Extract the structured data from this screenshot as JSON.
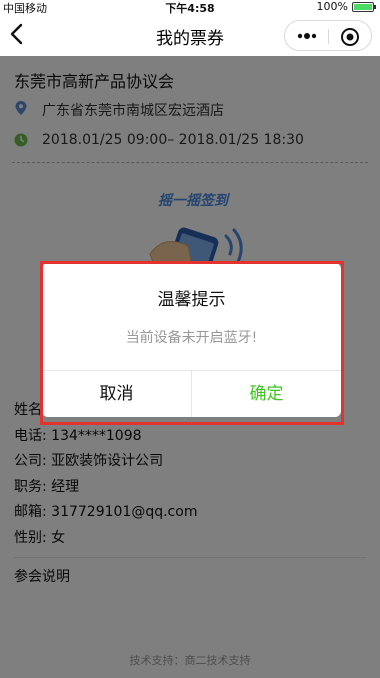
{
  "status_bar": {
    "carrier": "中国移动",
    "time": "下午4:58",
    "battery": "100%",
    "battery_level": 1.0
  },
  "nav": {
    "title": "我的票券",
    "back_icon": "chevron-left-icon",
    "more_icon": "more-dots-icon",
    "close_icon": "target-circle-icon"
  },
  "event": {
    "title": "东莞市高新产品协议会",
    "address": "广东省东莞市南城区宏远酒店",
    "time_range": "2018.01/25 09:00– 2018.01/25 18:30",
    "location_icon": "location-pin-icon",
    "clock_icon": "clock-icon"
  },
  "shake": {
    "label": "摇一摇签到",
    "icon": "hand-phone-icon"
  },
  "details": {
    "name": "姓名",
    "phone": "电话: 134****1098",
    "company": "公司: 亚欧装饰设计公司",
    "position": "职务: 经理",
    "email": "邮箱: 317729101@qq.com",
    "gender": "性别: 女",
    "section": "参会说明"
  },
  "footer": {
    "text": "技术支持：商二技术支持"
  },
  "dialog": {
    "title": "温馨提示",
    "message": "当前设备未开启蓝牙!",
    "cancel": "取消",
    "confirm": "确定"
  },
  "colors": {
    "accent_green": "#3cc51f",
    "highlight_red": "#e2332f",
    "shake_blue": "#4a8ae0"
  }
}
